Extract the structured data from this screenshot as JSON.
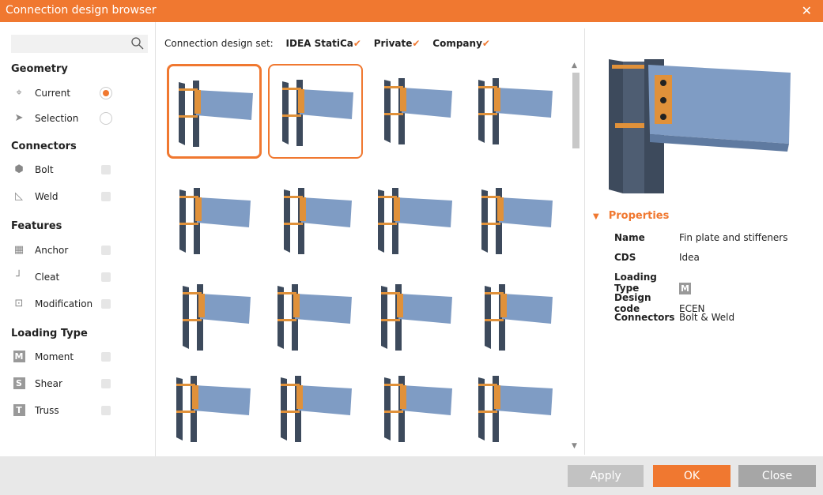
{
  "window": {
    "title": "Connection design browser",
    "close_icon": "close-icon"
  },
  "search": {
    "placeholder": "",
    "value": ""
  },
  "filters": {
    "geometry": {
      "title": "Geometry",
      "items": [
        {
          "label": "Current",
          "icon": "crosshair-icon",
          "selected": true
        },
        {
          "label": "Selection",
          "icon": "cursor-icon",
          "selected": false
        }
      ]
    },
    "connectors": {
      "title": "Connectors",
      "items": [
        {
          "label": "Bolt",
          "icon": "bolt-icon"
        },
        {
          "label": "Weld",
          "icon": "weld-icon"
        }
      ]
    },
    "features": {
      "title": "Features",
      "items": [
        {
          "label": "Anchor",
          "icon": "anchor-icon"
        },
        {
          "label": "Cleat",
          "icon": "cleat-icon"
        },
        {
          "label": "Modification",
          "icon": "modification-icon"
        }
      ]
    },
    "loading": {
      "title": "Loading Type",
      "items": [
        {
          "label": "Moment",
          "badge": "M"
        },
        {
          "label": "Shear",
          "badge": "S"
        },
        {
          "label": "Truss",
          "badge": "T"
        }
      ]
    }
  },
  "design_set": {
    "label": "Connection design set:",
    "options": [
      {
        "label": "IDEA StatiCa",
        "checked": true
      },
      {
        "label": "Private",
        "checked": true
      },
      {
        "label": "Company",
        "checked": true
      }
    ]
  },
  "gallery": {
    "selected_index": 0,
    "hovered_index": 1
  },
  "properties": {
    "title": "Properties",
    "rows": [
      {
        "key": "Name",
        "value": "Fin plate and stiffeners"
      },
      {
        "key": "CDS",
        "value": "Idea"
      },
      {
        "key": "Loading Type",
        "value": "M"
      },
      {
        "key": "Design code",
        "value": "ECEN"
      },
      {
        "key": "Connectors",
        "value": "Bolt & Weld"
      }
    ]
  },
  "buttons": {
    "apply": "Apply",
    "ok": "OK",
    "close": "Close"
  },
  "colors": {
    "accent": "#F07830",
    "steel_column": "#3d4a5c",
    "steel_beam": "#7f9cc4",
    "plate": "#e0913a"
  }
}
